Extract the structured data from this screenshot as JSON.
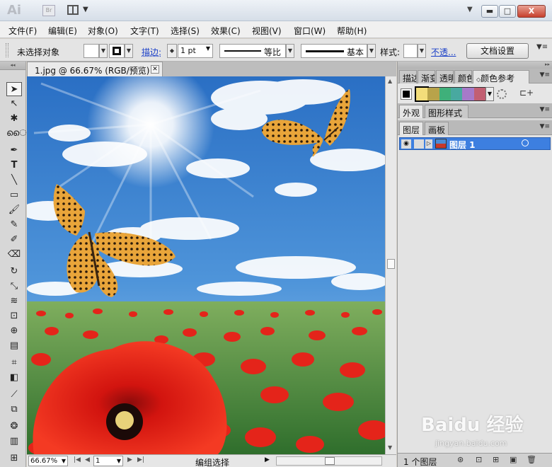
{
  "window": {
    "app_logo": "Ai",
    "bridge_label": "Br",
    "arrange_icon": "arrange-documents-icon",
    "min_label": "▬",
    "max_label": "□",
    "close_label": "X"
  },
  "menu": [
    "文件(F)",
    "编辑(E)",
    "对象(O)",
    "文字(T)",
    "选择(S)",
    "效果(C)",
    "视图(V)",
    "窗口(W)",
    "帮助(H)"
  ],
  "control": {
    "selection_status": "未选择对象",
    "stroke_label": "描边:",
    "stroke_weight": "1 pt",
    "profile_label": "等比",
    "brush_label": "基本",
    "style_label": "样式:",
    "opacity_link": "不透...",
    "doc_setup_button": "文档设置"
  },
  "document": {
    "tab_title": "1.jpg @ 66.67% (RGB/预览)",
    "zoom": "66.67%",
    "artboard": "1",
    "status_text": "编组选择"
  },
  "panels": {
    "top_tabs": [
      "描边",
      "渐变",
      "透明",
      "颜色",
      "颜色参考"
    ],
    "swatch_colors": [
      "#f3dd7a",
      "#b8a34a",
      "#3fb07a",
      "#48a9a0",
      "#a67ac9",
      "#c25f72"
    ],
    "mid_tabs": [
      "外观",
      "图形样式"
    ],
    "layer_tabs": [
      "图层",
      "画板"
    ],
    "layer_name": "图层 1",
    "layer_count": "1 个图层"
  },
  "watermark": {
    "brand": "Baidu 经验",
    "url": "jingyan.baidu.com"
  }
}
